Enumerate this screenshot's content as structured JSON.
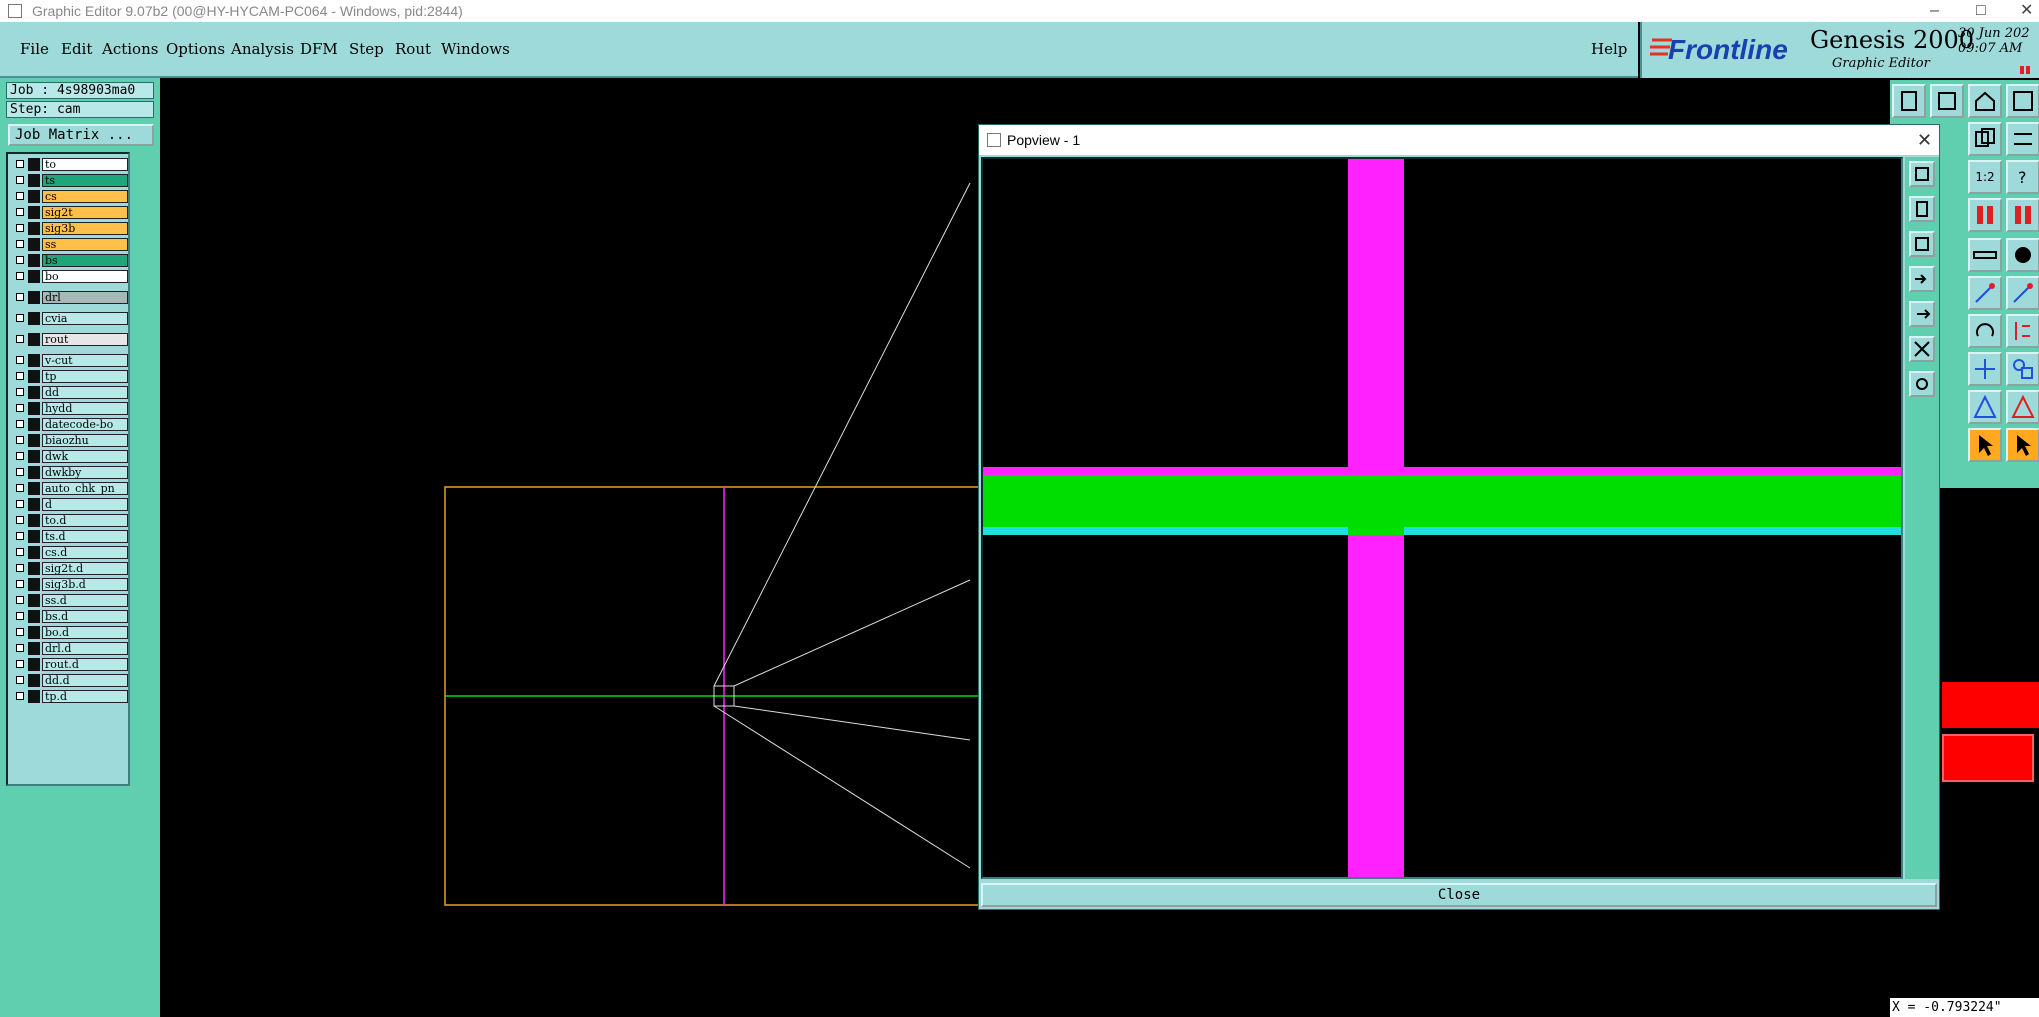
{
  "window": {
    "title": "Graphic Editor 9.07b2 (00@HY-HYCAM-PC064 - Windows, pid:2844)",
    "minimize": "–",
    "maximize": "□",
    "close": "✕"
  },
  "menu": {
    "items": [
      {
        "label": "File"
      },
      {
        "label": "Edit"
      },
      {
        "label": "Actions"
      },
      {
        "label": "Options"
      },
      {
        "label": "Analysis"
      },
      {
        "label": "DFM"
      },
      {
        "label": "Step"
      },
      {
        "label": "Rout"
      },
      {
        "label": "Windows"
      }
    ],
    "help": "Help"
  },
  "brand": {
    "logo": "Frontline",
    "product": "Genesis 2000",
    "subtitle": "Graphic Editor",
    "date": "30 Jun 202",
    "time": "09:07 AM"
  },
  "job": {
    "job_line": "Job : 4s98903ma0",
    "step_line": "Step: cam",
    "matrix_button": "Job Matrix ..."
  },
  "layers": [
    {
      "name": "to",
      "color": "#ffffff"
    },
    {
      "name": "ts",
      "color": "#1fa57a"
    },
    {
      "name": "cs",
      "color": "#ffc048"
    },
    {
      "name": "sig2t",
      "color": "#ffc048"
    },
    {
      "name": "sig3b",
      "color": "#ffc048"
    },
    {
      "name": "ss",
      "color": "#ffc048"
    },
    {
      "name": "bs",
      "color": "#1fa57a"
    },
    {
      "name": "bo",
      "color": "#ffffff"
    },
    {
      "name": "drl",
      "color": "#a8b8b8"
    },
    {
      "name": "cvia",
      "color": "#b8e8e8"
    },
    {
      "name": "rout",
      "color": "#e6e6e6"
    },
    {
      "name": "v-cut",
      "color": "#b8e8e8"
    },
    {
      "name": "tp",
      "color": "#b8e8e8"
    },
    {
      "name": "dd",
      "color": "#b8e8e8"
    },
    {
      "name": "hydd",
      "color": "#b8e8e8"
    },
    {
      "name": "datecode-bo",
      "color": "#b8e8e8"
    },
    {
      "name": "biaozhu",
      "color": "#b8e8e8"
    },
    {
      "name": "dwk",
      "color": "#b8e8e8"
    },
    {
      "name": "dwkby",
      "color": "#b8e8e8"
    },
    {
      "name": "auto_chk_pn",
      "color": "#b8e8e8"
    },
    {
      "name": "d",
      "color": "#b8e8e8"
    },
    {
      "name": "to.d",
      "color": "#b8e8e8"
    },
    {
      "name": "ts.d",
      "color": "#b8e8e8"
    },
    {
      "name": "cs.d",
      "color": "#b8e8e8"
    },
    {
      "name": "sig2t.d",
      "color": "#b8e8e8"
    },
    {
      "name": "sig3b.d",
      "color": "#b8e8e8"
    },
    {
      "name": "ss.d",
      "color": "#b8e8e8"
    },
    {
      "name": "bs.d",
      "color": "#b8e8e8"
    },
    {
      "name": "bo.d",
      "color": "#b8e8e8"
    },
    {
      "name": "drl.d",
      "color": "#b8e8e8"
    },
    {
      "name": "rout.d",
      "color": "#b8e8e8"
    },
    {
      "name": "dd.d",
      "color": "#b8e8e8"
    },
    {
      "name": "tp.d",
      "color": "#b8e8e8"
    }
  ],
  "toolbar": {
    "zoom_one_label": "1:2"
  },
  "popview": {
    "title": "Popview - 1",
    "close_x": "✕",
    "close_button": "Close"
  },
  "status": {
    "coords": "X = -0.793224\""
  },
  "colors": {
    "panel": "#9fdada",
    "panel_dark": "#5fcfb0",
    "magenta": "#ff22ff",
    "green": "#00dd00",
    "cyan": "#22dddd",
    "orange": "#e8a020"
  }
}
